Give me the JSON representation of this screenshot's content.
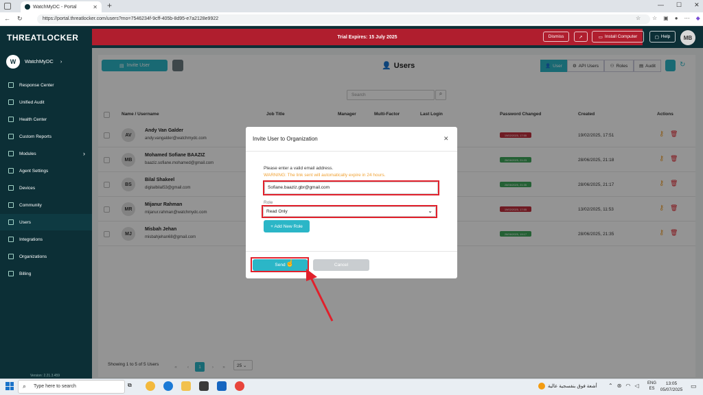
{
  "browser": {
    "tab_title": "WatchMyDC - Portal",
    "url": "https://portal.threatlocker.com/users?mo=7546234f-9cff-405b-8d95-e7a2128e9922"
  },
  "header": {
    "logo": "THREATLOCKER",
    "trial_text": "Trial Expires: 15 July 2025",
    "dismiss": "Dismiss",
    "install_computer": "Install Computer",
    "help": "Help",
    "avatar": "MB"
  },
  "sidebar": {
    "workspace_initial": "W",
    "workspace_name": "WatchMyDC",
    "items": [
      {
        "label": "Response Center"
      },
      {
        "label": "Unified Audit"
      },
      {
        "label": "Health Center"
      },
      {
        "label": "Custom Reports"
      },
      {
        "label": "Modules"
      },
      {
        "label": "Agent Settings"
      },
      {
        "label": "Devices"
      },
      {
        "label": "Community"
      },
      {
        "label": "Users"
      },
      {
        "label": "Integrations"
      },
      {
        "label": "Organizations"
      },
      {
        "label": "Billing"
      }
    ],
    "version": "Version: 2.21.3.459"
  },
  "page": {
    "invite_user": "Invite User",
    "title": "Users",
    "tabs": [
      "User",
      "API Users",
      "Roles",
      "Audit"
    ],
    "search_placeholder": "Search"
  },
  "table": {
    "headers": [
      "Name / Username",
      "Job Title",
      "Manager",
      "Multi-Factor",
      "Last Login",
      "Password Changed",
      "Created",
      "Actions"
    ],
    "rows": [
      {
        "initials": "AV",
        "name": "Andy Van Galder",
        "email": "andy.vangalder@watchmydc.com",
        "pw_status": "19/02/2025, 17:55",
        "pw_color": "#c0303d",
        "created": "19/02/2025, 17:51"
      },
      {
        "initials": "MB",
        "name": "Mohamed Sofiane BAAZIZ",
        "email": "baaziz.sofiane.mohamed@gmail.com",
        "pw_status": "28/06/2025, 21:23",
        "pw_color": "#3ea55a",
        "created": "28/06/2025, 21:18"
      },
      {
        "initials": "BS",
        "name": "Bilal  Shakeel",
        "email": "digitalbilal53@gmail.com",
        "pw_status": "28/06/2025, 21:35",
        "pw_color": "#3ea55a",
        "created": "28/06/2025, 21:17"
      },
      {
        "initials": "MR",
        "name": "Mijanur Rahman",
        "email": "mijanur.rahman@watchmydc.com",
        "pw_status": "19/02/2025, 17:55",
        "pw_color": "#c0303d",
        "created": "13/02/2025, 11:53"
      },
      {
        "initials": "MJ",
        "name": "Misbah Jehan",
        "email": "misbahjehan68@gmail.com",
        "pw_status": "28/06/2025, 19:17",
        "pw_color": "#3ea55a",
        "created": "28/06/2025, 21:35"
      }
    ],
    "showing": "Showing 1 to 5 of 5 Users",
    "current_page": "1",
    "page_size": "25"
  },
  "modal": {
    "title": "Invite User to Organization",
    "instruction": "Please enter a valid email address.",
    "warning": "WARNING: The link sent will automatically expire in 24 hours.",
    "email_value": "Sofiane.baaziz.gbr@gmail.com",
    "role_label": "Role",
    "role_value": "Read Only",
    "add_role": "+ Add New Role",
    "send": "Send",
    "cancel": "Cancel"
  },
  "taskbar": {
    "search_placeholder": "Type here to search",
    "weather_text": "أشعة فوق بنفسجية عالية",
    "lang_top": "ENG",
    "lang_bottom": "ES",
    "time": "13:05",
    "date": "05/07/2025"
  },
  "colors": {
    "teal": "#2bb6c7",
    "dark": "#0c2f36",
    "red": "#e1202b"
  }
}
